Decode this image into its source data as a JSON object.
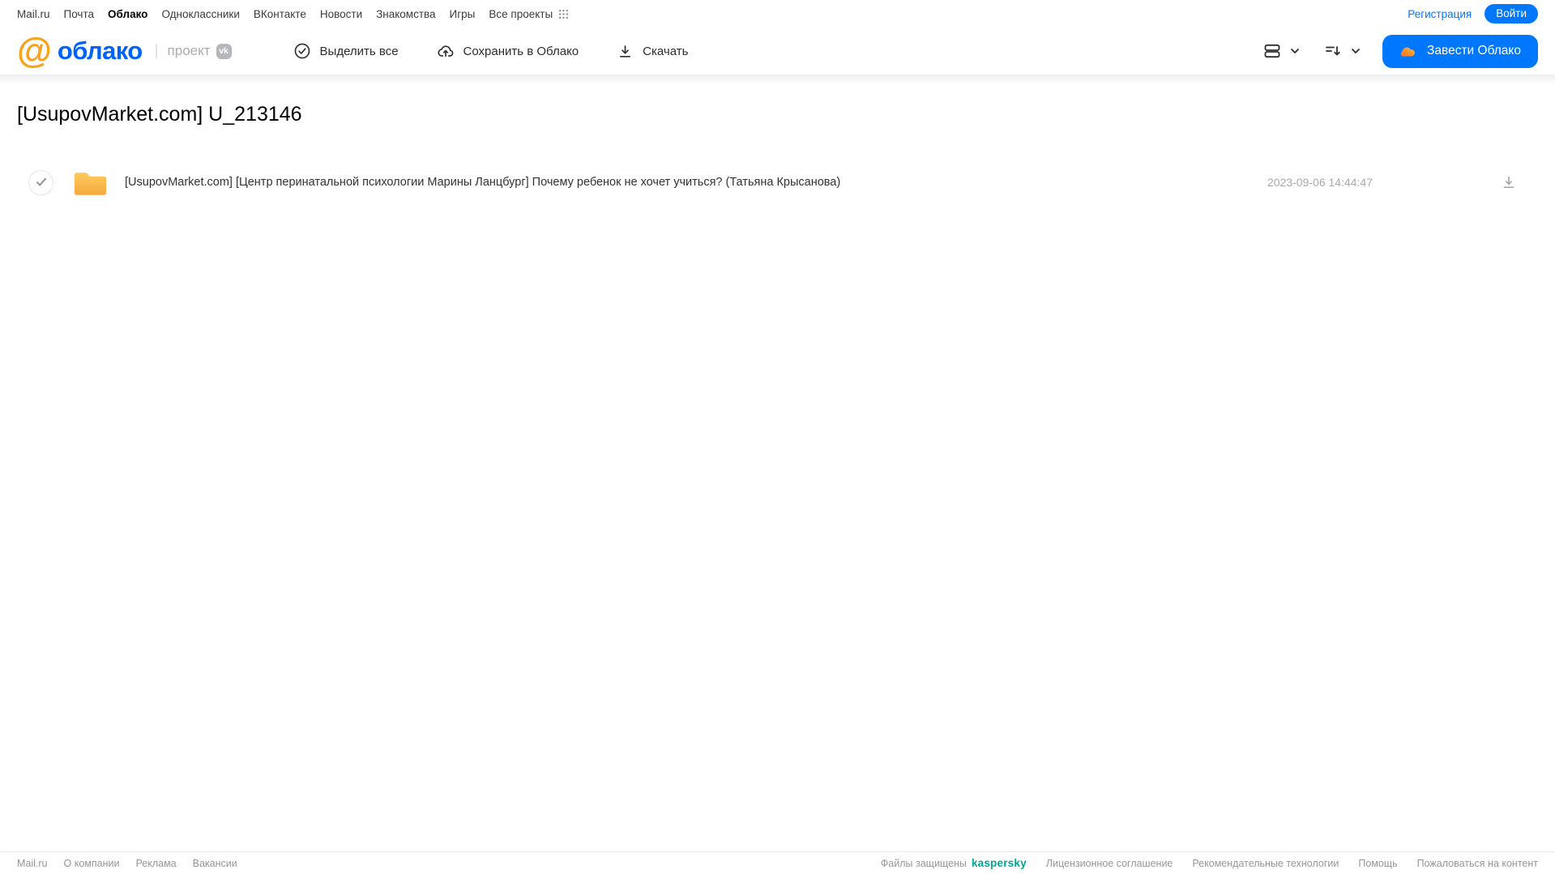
{
  "topnav": {
    "links": [
      "Mail.ru",
      "Почта",
      "Облако",
      "Одноклассники",
      "ВКонтакте",
      "Новости",
      "Знакомства",
      "Игры",
      "Все проекты"
    ],
    "registration": "Регистрация",
    "login": "Войти"
  },
  "header": {
    "logo_at": "@",
    "logo_text": "облако",
    "divider": "|",
    "project_label": "проект",
    "vk_badge": "vk",
    "toolbar": {
      "select_all": "Выделить все",
      "save_to_cloud": "Сохранить в Облако",
      "download": "Скачать"
    },
    "create_cloud_button": "Завести Облако"
  },
  "main": {
    "title": "[UsupovMarket.com] U_213146",
    "file": {
      "type": "folder",
      "name": "[UsupovMarket.com] [Центр перинатальной психологии Марины Ланцбург] Почему ребенок не хочет учиться? (Татьяна Крысанова)",
      "date": "2023-09-06 14:44:47"
    }
  },
  "footer": {
    "links_left": [
      "Mail.ru",
      "О компании",
      "Реклама",
      "Вакансии"
    ],
    "protected_label": "Файлы защищены",
    "kaspersky": "kaspersky",
    "links_right": [
      "Лицензионное соглашение",
      "Рекомендательные технологии",
      "Помощь",
      "Пожаловаться на контент"
    ]
  },
  "colors": {
    "accent_blue": "#0077ff",
    "logo_blue": "#0062f9",
    "logo_orange": "#f9a21b",
    "folder_top": "#ffca5e",
    "folder_bottom": "#f5a93c",
    "kaspersky_green": "#00a88e"
  }
}
